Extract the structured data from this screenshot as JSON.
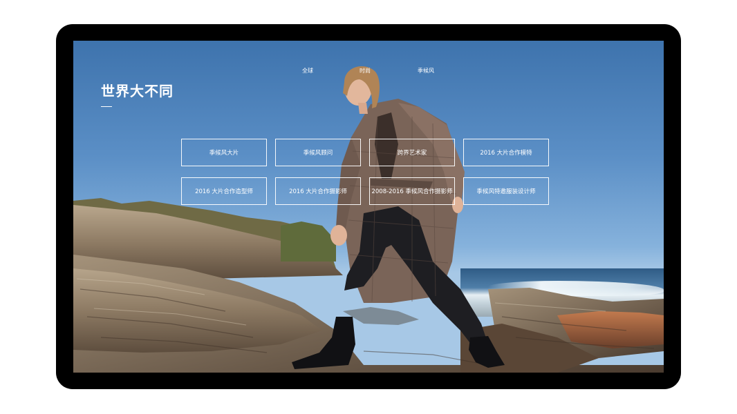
{
  "nav": {
    "items": [
      "全球",
      "时尚",
      "季候风"
    ]
  },
  "hero": {
    "title": "世界大不同"
  },
  "grid": {
    "items": [
      "季候风大片",
      "季候风顾问",
      "跨界艺术家",
      "2016 大片合作模特",
      "2016 大片合作造型师",
      "2016 大片合作摄影师",
      "2008-2016 季候风合作摄影师",
      "季候风特邀服装设计师"
    ]
  },
  "colors": {
    "device_frame": "#000000",
    "sky_top": "#3e73ad",
    "text": "#ffffff"
  }
}
